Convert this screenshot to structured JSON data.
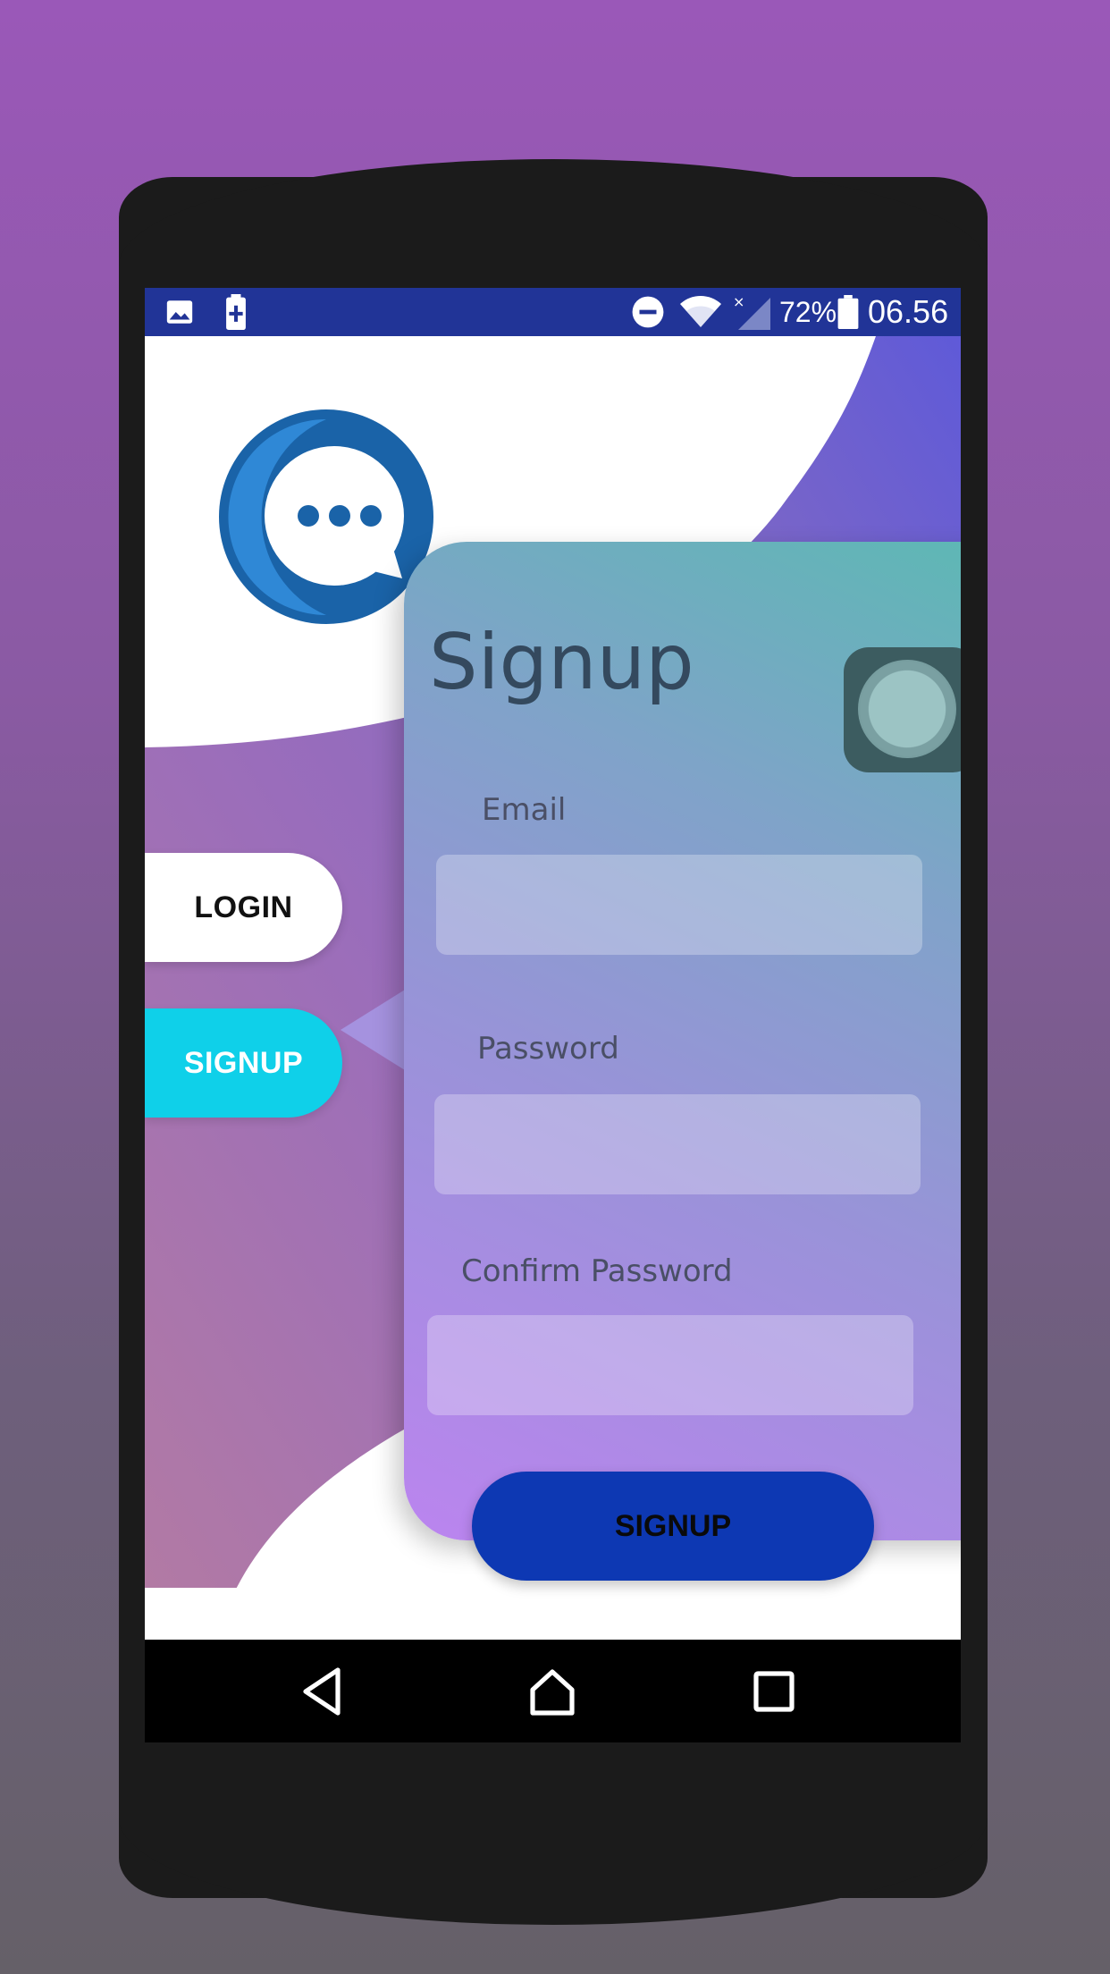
{
  "status_bar": {
    "icons": [
      "image-icon",
      "battery-saver-icon",
      "do-not-disturb-icon",
      "wifi-icon",
      "signal-icon",
      "battery-icon"
    ],
    "battery_percent": "72%",
    "time": "06.56"
  },
  "logo": {
    "name": "chat-bubble-logo"
  },
  "tabs": {
    "login_label": "LOGIN",
    "signup_label": "SIGNUP"
  },
  "form": {
    "title": "Signup",
    "email_label": "Email",
    "email_value": "",
    "password_label": "Password",
    "password_value": "",
    "confirm_label": "Confirm Password",
    "confirm_value": "",
    "submit_label": "SIGNUP"
  },
  "nav": {
    "icons": [
      "back-icon",
      "home-icon",
      "recents-icon"
    ]
  },
  "colors": {
    "status_bar": "#213497",
    "tab_active": "#0fd0e9",
    "submit_button": "#0d38b3",
    "wave_purple": "#6f5ad4"
  }
}
